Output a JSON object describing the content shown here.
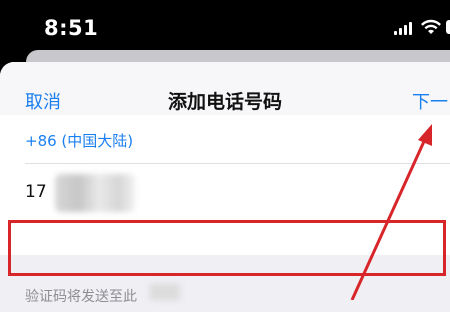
{
  "status_bar": {
    "time": "8:51"
  },
  "nav": {
    "cancel": "取消",
    "title": "添加电话号码",
    "next": "下一"
  },
  "country": "+86 (中国大陆)",
  "phone_prefix": "17",
  "hint": "验证码将发送至此",
  "colors": {
    "accent": "#1a7ff0",
    "annotation": "#d8252a"
  }
}
